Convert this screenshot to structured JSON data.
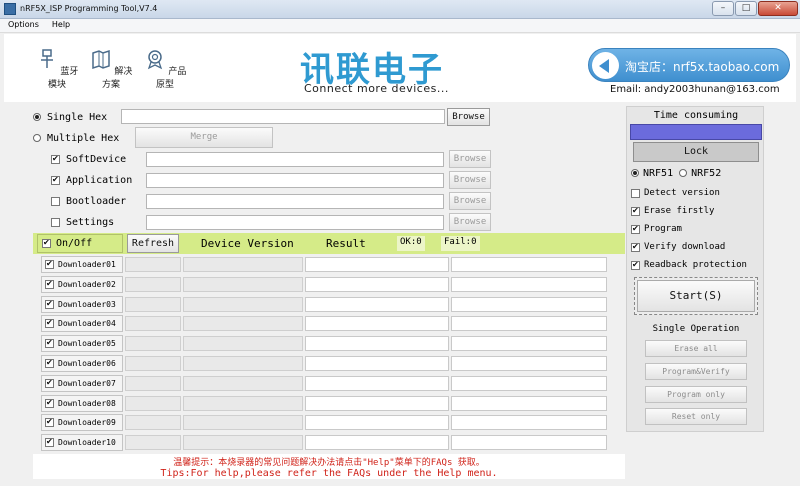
{
  "window": {
    "title": "nRF5X_ISP Programming Tool,V7.4",
    "controls": {
      "minimize": "–",
      "maximize": "□",
      "close": "✕"
    }
  },
  "menu": {
    "items": [
      "Options",
      "Help"
    ]
  },
  "header": {
    "buttons": [
      {
        "label": "蓝牙模块",
        "icon": "bluetooth-module-icon"
      },
      {
        "label": "解决方案",
        "icon": "solution-icon"
      },
      {
        "label": "产品原型",
        "icon": "prototype-icon"
      }
    ],
    "brand_cn": "讯联电子",
    "brand_en": "Connect more devices...",
    "taobao": "淘宝店：nrf5x.taobao.com",
    "email": "Email: andy2003hunan@163.com"
  },
  "hex": {
    "single_label": "Single Hex",
    "single_selected": true,
    "single_value": "",
    "multiple_label": "Multiple Hex",
    "merge_label": "Merge",
    "browse_label": "Browse",
    "parts": [
      {
        "label": "SoftDevice",
        "checked": true,
        "value": ""
      },
      {
        "label": "Application",
        "checked": true,
        "value": ""
      },
      {
        "label": "Bootloader",
        "checked": false,
        "value": ""
      },
      {
        "label": "Settings",
        "checked": false,
        "value": ""
      }
    ]
  },
  "status": {
    "on_off_label": "On/Off",
    "on_off_checked": true,
    "refresh_label": "Refresh",
    "device_version_label": "Device Version",
    "result_label": "Result",
    "ok_label": "OK:0",
    "fail_label": "Fail:0"
  },
  "downloaders": [
    {
      "label": "Downloader01",
      "checked": true
    },
    {
      "label": "Downloader02",
      "checked": true
    },
    {
      "label": "Downloader03",
      "checked": true
    },
    {
      "label": "Downloader04",
      "checked": true
    },
    {
      "label": "Downloader05",
      "checked": true
    },
    {
      "label": "Downloader06",
      "checked": true
    },
    {
      "label": "Downloader07",
      "checked": true
    },
    {
      "label": "Downloader08",
      "checked": true
    },
    {
      "label": "Downloader09",
      "checked": true
    },
    {
      "label": "Downloader10",
      "checked": true
    }
  ],
  "tips": {
    "cn": "温馨提示：本烧录器的常见问题解决办法请点击\"Help\"菜单下的FAQs 获取。",
    "en": "Tips:For help,please refer the FAQs under the Help menu."
  },
  "right": {
    "time_label": "Time consuming",
    "lock_label": "Lock",
    "chip_nrf51": "NRF51",
    "chip_nrf52": "NRF52",
    "chip_selected": "NRF51",
    "options": [
      {
        "label": "Detect version",
        "checked": false
      },
      {
        "label": "Erase firstly",
        "checked": true
      },
      {
        "label": "Program",
        "checked": true
      },
      {
        "label": "Verify download",
        "checked": true
      },
      {
        "label": "Readback protection",
        "checked": true
      }
    ],
    "start_label": "Start(S)",
    "single_op_label": "Single Operation",
    "op_buttons": [
      "Erase all",
      "Program&Verify",
      "Program only",
      "Reset only"
    ]
  },
  "colors": {
    "status_bar": "#d5eb88",
    "time_bar": "#6b6bdc",
    "brand": "#2f9ad1",
    "tip_text": "#d0231a"
  }
}
